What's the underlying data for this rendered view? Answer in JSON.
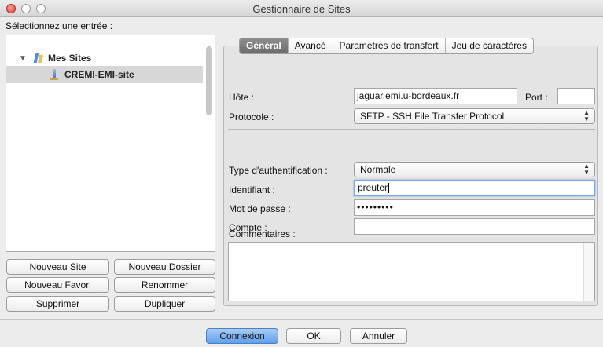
{
  "window": {
    "title": "Gestionnaire de Sites"
  },
  "left": {
    "select_label": "Sélectionnez une entrée :",
    "tree": {
      "root_label": "Mes Sites",
      "child_label": "CREMI-EMI-site"
    },
    "buttons": {
      "new_site": "Nouveau Site",
      "new_folder": "Nouveau Dossier",
      "new_bookmark": "Nouveau Favori",
      "rename": "Renommer",
      "delete": "Supprimer",
      "duplicate": "Dupliquer"
    }
  },
  "tabs": [
    {
      "label": "Général",
      "active": true
    },
    {
      "label": "Avancé",
      "active": false
    },
    {
      "label": "Paramètres de transfert",
      "active": false
    },
    {
      "label": "Jeu de caractères",
      "active": false
    }
  ],
  "form": {
    "host_label": "Hôte :",
    "host_value": "jaguar.emi.u-bordeaux.fr",
    "port_label": "Port :",
    "port_value": "",
    "protocol_label": "Protocole :",
    "protocol_value": "SFTP - SSH File Transfer Protocol",
    "auth_label": "Type d'authentification :",
    "auth_value": "Normale",
    "user_label": "Identifiant :",
    "user_value": "preuter",
    "password_label": "Mot de passe :",
    "password_value": "•••••••••",
    "account_label": "Compte :",
    "account_value": "",
    "comments_label": "Commentaires :"
  },
  "bottom": {
    "connect": "Connexion",
    "ok": "OK",
    "cancel": "Annuler"
  }
}
